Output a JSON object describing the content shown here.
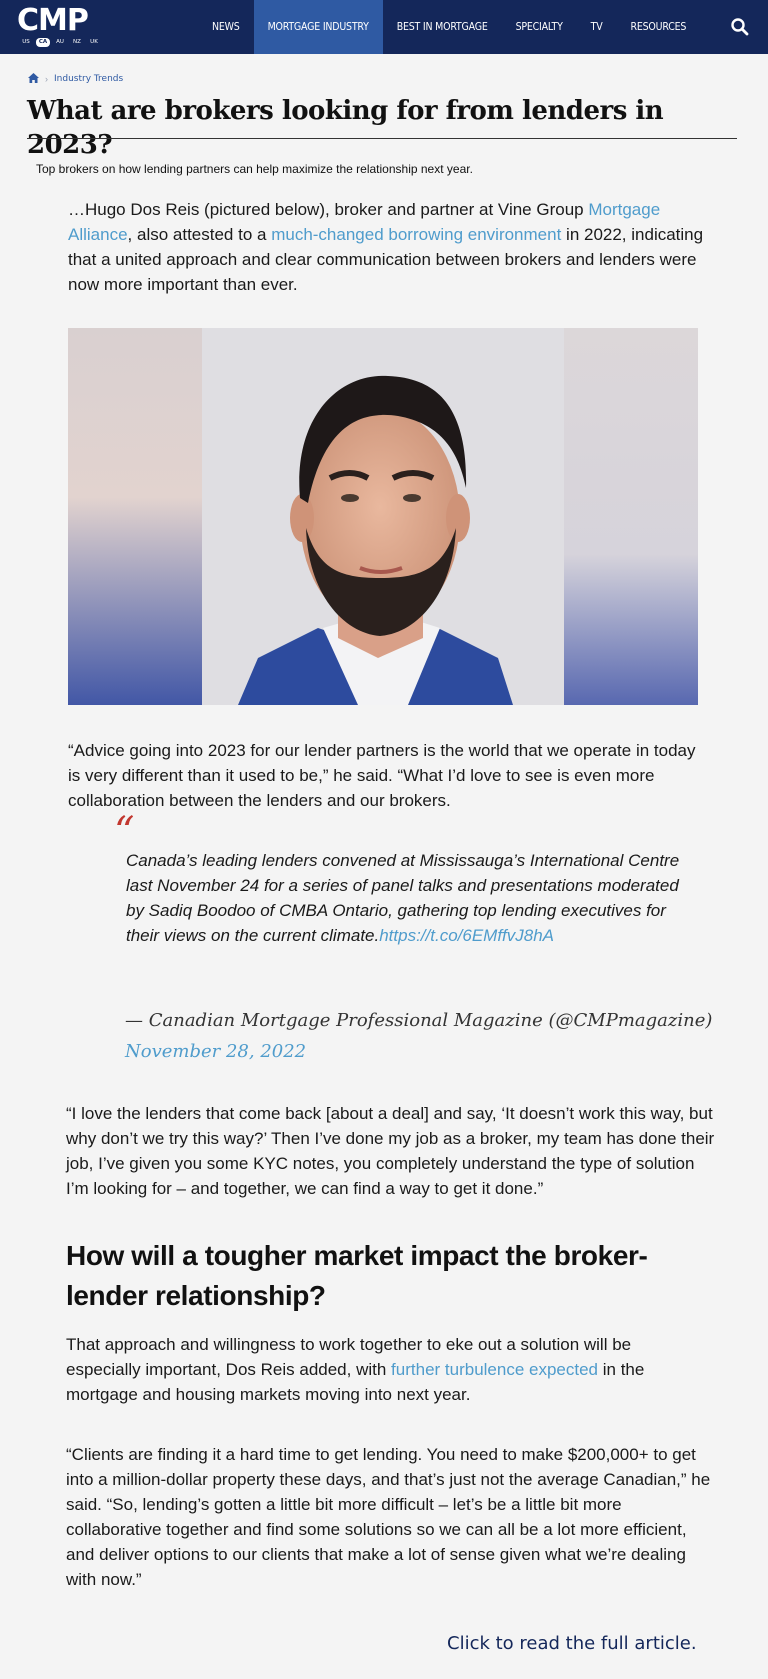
{
  "header": {
    "logo": "CMP",
    "regions": [
      "US",
      "CA",
      "AU",
      "NZ",
      "UK"
    ],
    "active_region": "CA",
    "nav": [
      "NEWS",
      "MORTGAGE INDUSTRY",
      "BEST IN MORTGAGE",
      "SPECIALTY",
      "TV",
      "RESOURCES"
    ],
    "active_nav": "MORTGAGE INDUSTRY"
  },
  "breadcrumb": {
    "home_icon": "home-icon",
    "section": "Industry Trends"
  },
  "article": {
    "title": "What are brokers looking for from lenders in 2023?",
    "dek": "Top brokers on how lending partners can help maximize the relationship next year.",
    "p1": {
      "a": "…Hugo Dos Reis (pictured below), broker and partner at Vine Group ",
      "link1": "Mortgage Alliance",
      "b": ", also attested to a ",
      "link2": "much-changed borrowing environment",
      "c": " in 2022, indicating that a united approach and clear communication between brokers and lenders were now more important than ever."
    },
    "p2": "“Advice going into 2023 for our lender partners is the world that we operate in today is very different than it used to be,” he said. “What I’d love to see is even more collaboration between the lenders and our brokers.",
    "tweet": {
      "text": "Canada’s leading lenders convened at Mississauga’s International Centre last November 24 for a series of panel talks and presentations moderated by Sadiq Boodoo of CMBA Ontario, gathering top lending executives for their views on the current climate.",
      "link": "https://t.co/6EMffvJ8hA",
      "author": "— Canadian Mortgage Professional Magazine (@CMPmagazine)",
      "date": "November 28, 2022"
    },
    "p3": "“I love the lenders that come back [about a deal] and say, ‘It doesn’t work this way, but why don’t we try this way?’ Then I’ve done my job as a broker, my team has done their job, I’ve given you some KYC notes, you completely understand the type of solution I’m looking for – and together, we can find a way to get it done.”",
    "h2": "How will a tougher market impact the broker-lender relationship?",
    "p4": {
      "a": "That approach and willingness to work together to eke out a solution will be especially important, Dos Reis added, with ",
      "link": "further turbulence expected",
      "b": " in the mortgage and housing markets moving into next year."
    },
    "p5": "“Clients are finding it a hard time to get lending. You need to make $200,000+ to get into a million-dollar property these days, and that’s just not the average Canadian,” he said. “So, lending’s gotten a little bit more difficult – let’s be a little bit more collaborative together and find some solutions so we can all be a lot more efficient, and deliver options to our clients that make a lot of sense given what we’re dealing with now.”",
    "cta": "Click to read the full article."
  },
  "colors": {
    "header_bg": "#14275a",
    "nav_active": "#2f5aa3",
    "link": "#4f9ccc",
    "quote_mark": "#c2372f"
  }
}
